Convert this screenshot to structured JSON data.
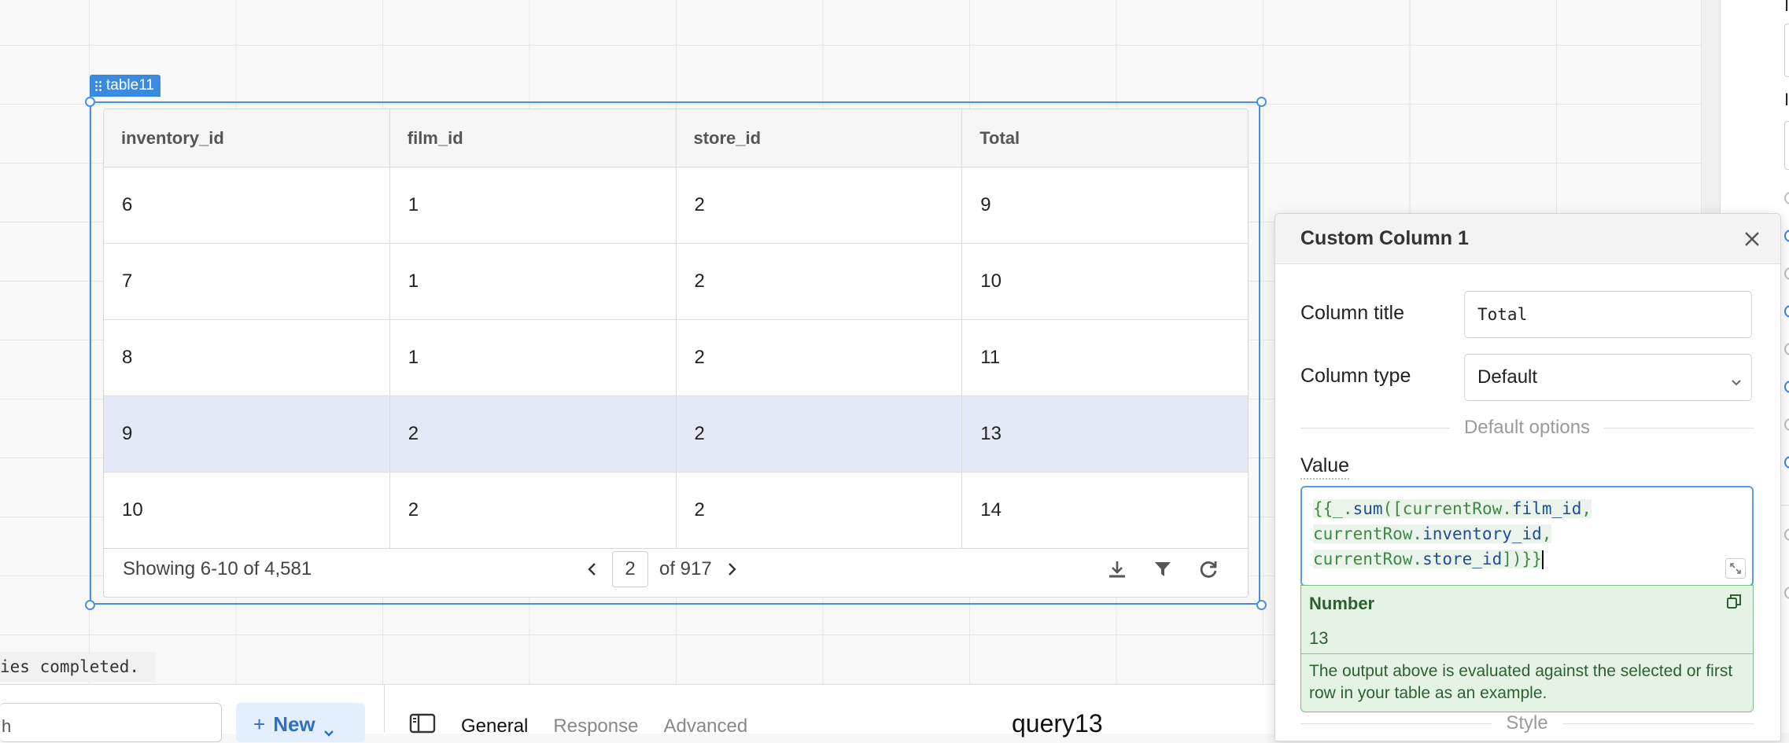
{
  "component": {
    "tag_label": "table11"
  },
  "table": {
    "columns": [
      "inventory_id",
      "film_id",
      "store_id",
      "Total"
    ],
    "rows": [
      [
        "6",
        "1",
        "2",
        "9"
      ],
      [
        "7",
        "1",
        "2",
        "10"
      ],
      [
        "8",
        "1",
        "2",
        "11"
      ],
      [
        "9",
        "2",
        "2",
        "13"
      ],
      [
        "10",
        "2",
        "2",
        "14"
      ]
    ],
    "selected_row_index": 3,
    "footer": {
      "showing": "Showing 6-10 of 4,581",
      "page": "2",
      "of_pages": "of 917"
    },
    "tool_icons": [
      "download-icon",
      "filter-icon",
      "refresh-icon"
    ]
  },
  "console": {
    "text": "ies completed."
  },
  "bottom": {
    "search_partial": "h",
    "new_button": "New",
    "tabs": [
      "General",
      "Response",
      "Advanced"
    ],
    "active_tab": "General",
    "query_name": "query13"
  },
  "modal": {
    "title": "Custom Column 1",
    "column_title_label": "Column title",
    "column_title_value": "Total",
    "column_type_label": "Column type",
    "column_type_value": "Default",
    "section_default": "Default options",
    "value_label": "Value",
    "code_lines": [
      "{{_.sum([currentRow.film_id,",
      "currentRow.inventory_id,",
      "currentRow.store_id])}}"
    ],
    "result_type": "Number",
    "result_value": "13",
    "result_note": "The output above is evaluated against the selected or first row in your table as an example.",
    "section_style": "Style"
  },
  "colors": {
    "accent": "#3a8be0",
    "selected_row": "#e5e8f7",
    "result_bg": "#e4f3e4"
  }
}
